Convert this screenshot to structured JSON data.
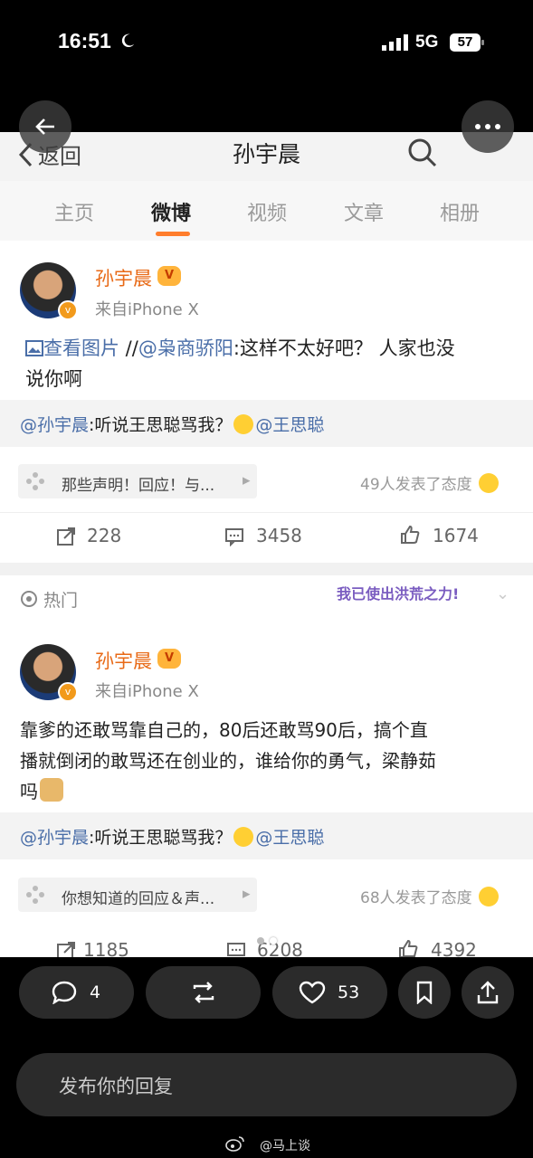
{
  "status": {
    "time": "16:51",
    "network": "5G",
    "battery": "57"
  },
  "weibo": {
    "back_label": "返回",
    "title": "孙宇晨",
    "tabs": [
      "主页",
      "微博",
      "视频",
      "文章",
      "相册"
    ],
    "active_tab": 1,
    "post1": {
      "username": "孙宇晨",
      "from": "来自iPhone X",
      "view_images": "查看图片",
      "slashes": " //",
      "mention": "@枭商骄阳",
      "text_line1": ":这样不太好吧？ 人家也没",
      "text_line2": "说你啊",
      "repost_mention": "@孙宇晨",
      "repost_text": ":听说王思聪骂我？",
      "repost_mention2": "@王思聪",
      "topic": "那些声明！回应！与...",
      "reactions": "49人发表了态度",
      "shares": "228",
      "comments": "3458",
      "likes": "1674"
    },
    "hot_label": "热门",
    "sticker_text": "我已使出洪荒之力!",
    "post2": {
      "username": "孙宇晨",
      "from": "来自iPhone X",
      "text_line1": "靠爹的还敢骂靠自己的，80后还敢骂90后，搞个直",
      "text_line2": "播就倒闭的敢骂还在创业的，谁给你的勇气，梁静茹",
      "text_line3": "吗",
      "repost_mention": "@孙宇晨",
      "repost_text": ":听说王思聪骂我？",
      "repost_mention2": "@王思聪",
      "topic": "你想知道的回应＆声...",
      "reactions": "68人发表了态度",
      "shares": "1185",
      "comments": "6208",
      "likes": "4392"
    }
  },
  "toolbar": {
    "comments": "4",
    "likes": "53"
  },
  "reply_placeholder": "发布你的回复",
  "watermark": "@马上谈",
  "colors": {
    "accent": "#ff7d2c",
    "link": "#4a6ea8",
    "username": "#e86a17",
    "background": "#000000"
  }
}
